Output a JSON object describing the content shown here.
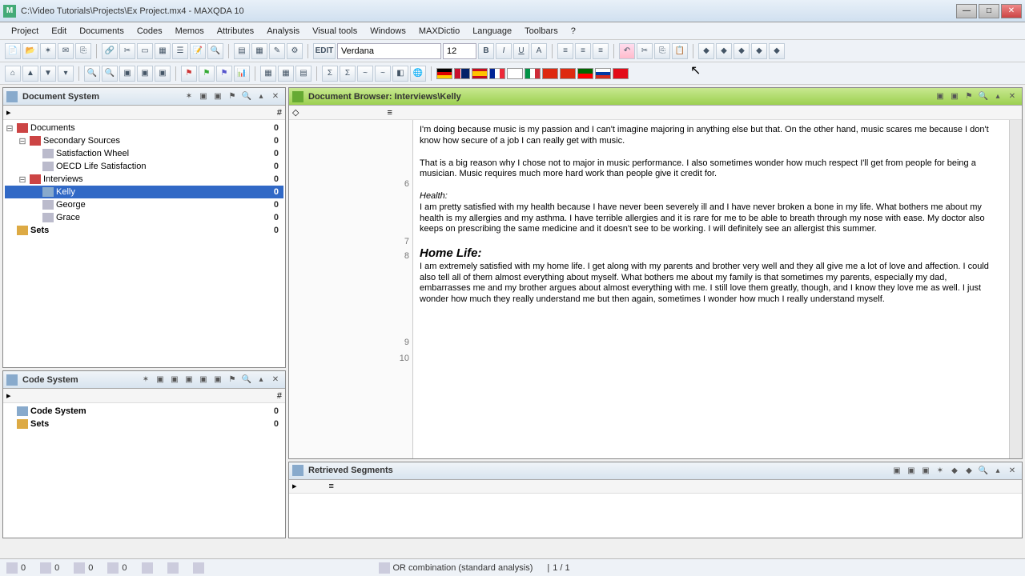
{
  "window": {
    "title": "C:\\Video Tutorials\\Projects\\Ex Project.mx4 - MAXQDA 10"
  },
  "menu": [
    "Project",
    "Edit",
    "Documents",
    "Codes",
    "Memos",
    "Attributes",
    "Analysis",
    "Visual tools",
    "Windows",
    "MAXDictio",
    "Language",
    "Toolbars",
    "?"
  ],
  "formatting": {
    "font": "Verdana",
    "size": "12"
  },
  "panels": {
    "doc_system": {
      "title": "Document System",
      "root": {
        "label": "Documents",
        "count": "0"
      },
      "secondary": {
        "label": "Secondary Sources",
        "count": "0"
      },
      "sat_wheel": {
        "label": "Satisfaction Wheel",
        "count": "0"
      },
      "oecd": {
        "label": "OECD Life Satisfaction",
        "count": "0"
      },
      "interviews": {
        "label": "Interviews",
        "count": "0"
      },
      "kelly": {
        "label": "Kelly",
        "count": "0"
      },
      "george": {
        "label": "George",
        "count": "0"
      },
      "grace": {
        "label": "Grace",
        "count": "0"
      },
      "sets": {
        "label": "Sets",
        "count": "0"
      }
    },
    "code_system": {
      "title": "Code System",
      "root": {
        "label": "Code System",
        "count": "0"
      },
      "sets": {
        "label": "Sets",
        "count": "0"
      }
    },
    "browser": {
      "title": "Document Browser: Interviews\\Kelly",
      "para": {
        "n6": "6",
        "n7": "7",
        "n8": "8",
        "n9": "9",
        "n10": "10"
      },
      "text": {
        "p1": "I'm doing because music is my passion and I can't imagine majoring in anything else but that.  On the other hand, music scares me because I don't know how secure of a job I can really get with music.",
        "p6": "That is a big reason why I chose not to major in music performance.  I also sometimes wonder how much respect I'll get from people for being a musician.  Music requires much more hard work than people give it credit for.",
        "p7": "Health:",
        "p8": "I am pretty satisfied with my health because I have never been severely ill and I have never broken a bone in my life.  What bothers me about my health is my allergies and my asthma.  I have terrible allergies and it is rare for me to be able to breath through my nose with ease.  My doctor also keeps on prescribing the same medicine and it doesn't see to be working. I will definitely see an allergist this summer.",
        "p9": "Home Life:",
        "p10": "I am extremely satisfied with my home life.  I get along with my parents and brother very well and they all give me a lot of love and affection.  I could also tell all of them almost everything about myself.  What bothers me about my family is that sometimes my parents, especially my dad, embarrasses me and my brother argues about almost everything with me.  I still love them greatly, though, and I know they love me as well.  I just wonder how much they really understand me but then again, sometimes I wonder how much I really understand myself."
      }
    },
    "retrieved": {
      "title": "Retrieved Segments"
    }
  },
  "status": {
    "s1": "0",
    "s2": "0",
    "s3": "0",
    "s4": "0",
    "analysis": "OR combination (standard analysis)",
    "page": "1 / 1"
  }
}
